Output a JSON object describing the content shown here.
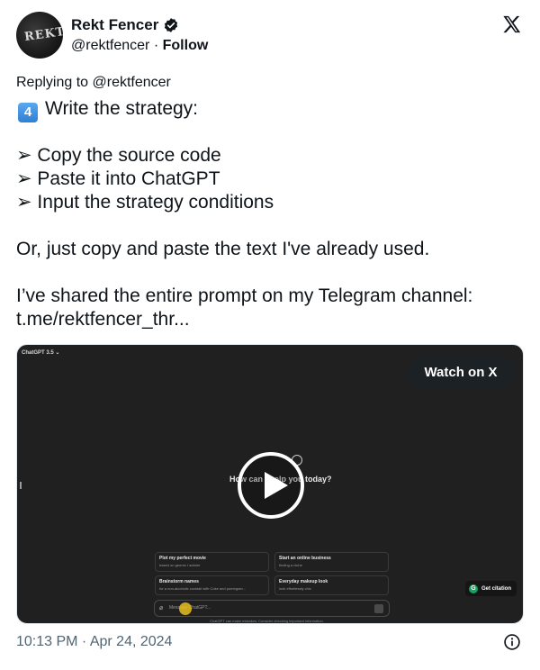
{
  "author": {
    "name": "Rekt Fencer",
    "handle": "@rektfencer",
    "separator": "·",
    "follow_label": "Follow",
    "avatar_text": "REKT"
  },
  "icons": {
    "verified": "verified-badge-icon",
    "x": "x-logo-icon",
    "info": "info-icon",
    "play": "play-icon",
    "keycap": "keycap-four-emoji"
  },
  "tweet": {
    "replying_to": "Replying to @rektfencer",
    "step_badge": "4",
    "step_title": "Write the strategy:",
    "bullets": [
      "➢ Copy the source code",
      "➢ Paste it into ChatGPT",
      "➢ Input the strategy conditions"
    ],
    "line_or": "Or, just copy and paste the text I've already used.",
    "line_shared": "I’ve shared the entire prompt on my Telegram channel:",
    "link": "t.me/rektfencer_thr..."
  },
  "video": {
    "watch_label": "Watch on X",
    "model_label": "ChatGPT 3.5 ⌄",
    "prompt": "How can I help you today?",
    "cards": [
      {
        "title": "Plot my perfect movie",
        "subtitle": "based on genres I admire"
      },
      {
        "title": "Start an online business",
        "subtitle": "finding a niche"
      },
      {
        "title": "Brainstorm names",
        "subtitle": "for a non-alcoholic cocktail with Coke and pomegran..."
      },
      {
        "title": "Everyday makeup look",
        "subtitle": "look effortlessly chic"
      }
    ],
    "message_placeholder": "Message ChatGPT...",
    "disclaimer": "ChatGPT can make mistakes. Consider checking important information.",
    "citation_label": "Get citation"
  },
  "footer": {
    "timestamp": "10:13 PM · Apr 24, 2024"
  },
  "colors": {
    "text": "#0f1419",
    "muted": "#536471",
    "video_bg": "#202020",
    "citation_green": "#15a25e"
  }
}
